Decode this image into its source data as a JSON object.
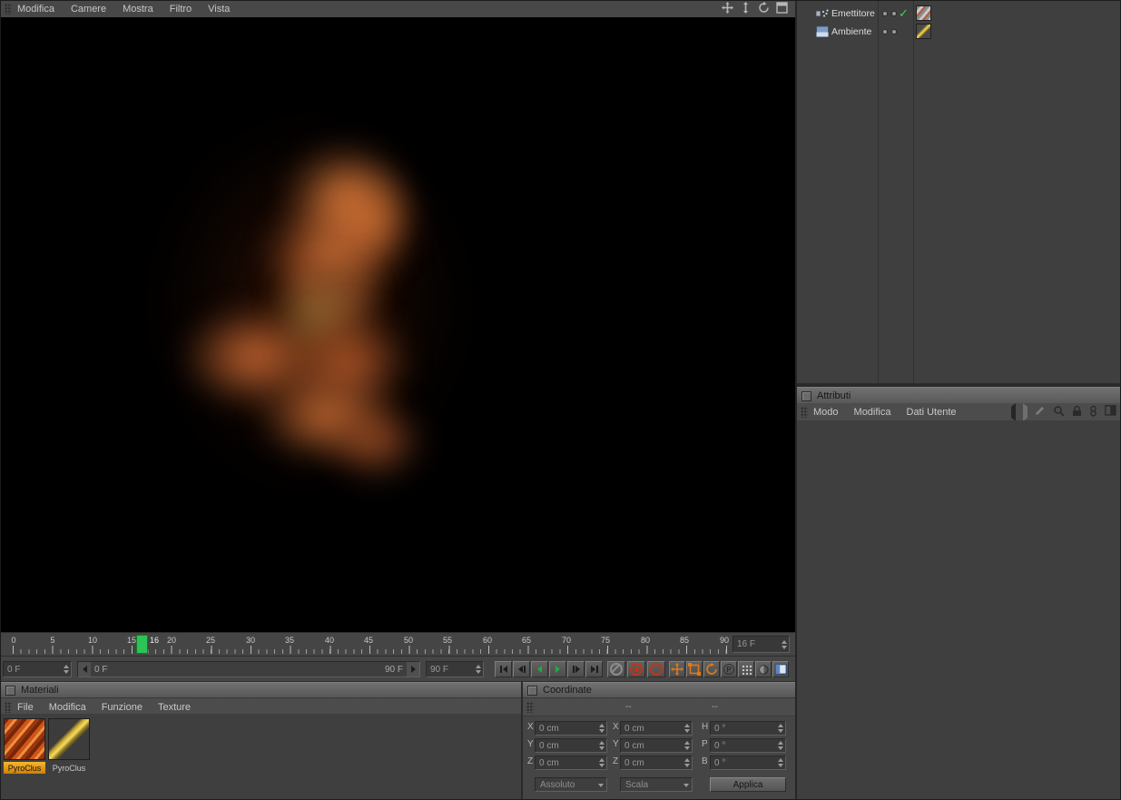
{
  "viewport_menu": {
    "items": [
      "Modifica",
      "Camere",
      "Mostra",
      "Filtro",
      "Vista"
    ]
  },
  "object_manager": {
    "objects": [
      {
        "name": "Emettitore"
      },
      {
        "name": "Ambiente"
      }
    ]
  },
  "attributes": {
    "title": "Attributi",
    "menu_items": [
      "Modo",
      "Modifica",
      "Dati Utente"
    ]
  },
  "timeline": {
    "ticks": [
      "0",
      "5",
      "10",
      "15",
      "20",
      "25",
      "30",
      "35",
      "40",
      "45",
      "50",
      "55",
      "60",
      "65",
      "70",
      "75",
      "80",
      "85",
      "90"
    ],
    "marker_label": "16",
    "current_frame": "16 F",
    "start_field": "0 F",
    "end_field": "90 F",
    "slider_start": "0 F",
    "slider_end": "90 F"
  },
  "materials": {
    "title": "Materiali",
    "menu_items": [
      "File",
      "Modifica",
      "Funzione",
      "Texture"
    ],
    "items": [
      {
        "name": "PyroClus",
        "selected": true
      },
      {
        "name": "PyroClus",
        "selected": false
      }
    ]
  },
  "coordinates": {
    "title": "Coordinate",
    "headers": [
      "--",
      "--"
    ],
    "rows": [
      {
        "l1": "X",
        "v1": "0 cm",
        "l2": "X",
        "v2": "0 cm",
        "l3": "H",
        "v3": "0 °"
      },
      {
        "l1": "Y",
        "v1": "0 cm",
        "l2": "Y",
        "v2": "0 cm",
        "l3": "P",
        "v3": "0 °"
      },
      {
        "l1": "Z",
        "v1": "0 cm",
        "l2": "Z",
        "v2": "0 cm",
        "l3": "B",
        "v3": "0 °"
      }
    ],
    "mode_dropdown": "Assoluto",
    "scale_dropdown": "Scala",
    "apply_label": "Applica"
  },
  "tool_glyphs": {
    "parameter": "P"
  },
  "colors": {
    "accent_green": "#2cc454",
    "record_red": "#c13418",
    "material_highlight": "#f0a420",
    "tool_orange": "#e07818"
  }
}
